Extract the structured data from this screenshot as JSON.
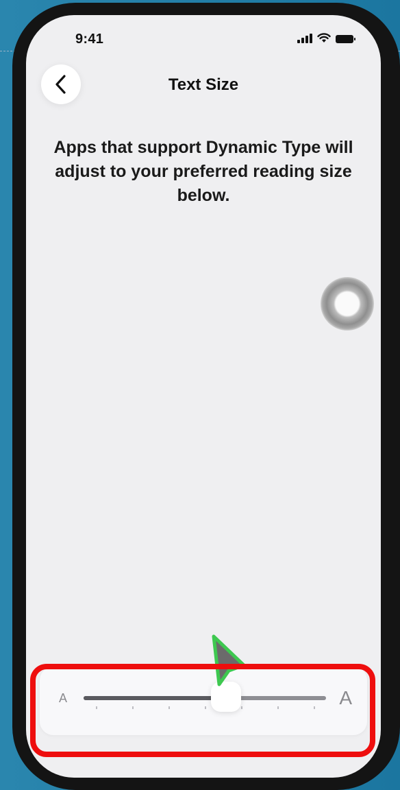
{
  "status_bar": {
    "time": "9:41"
  },
  "nav": {
    "back_icon": "chevron-left-icon",
    "title": "Text Size"
  },
  "description": "Apps that support Dynamic Type will adjust to your preferred reading size below.",
  "slider": {
    "min_label": "A",
    "max_label": "A",
    "value_step": 4,
    "step_count": 7
  },
  "colors": {
    "screen_background": "#efeff1",
    "highlight": "#ee0e0e",
    "cursor_fill": "#6b6b6b",
    "cursor_outline": "#3ec850"
  }
}
